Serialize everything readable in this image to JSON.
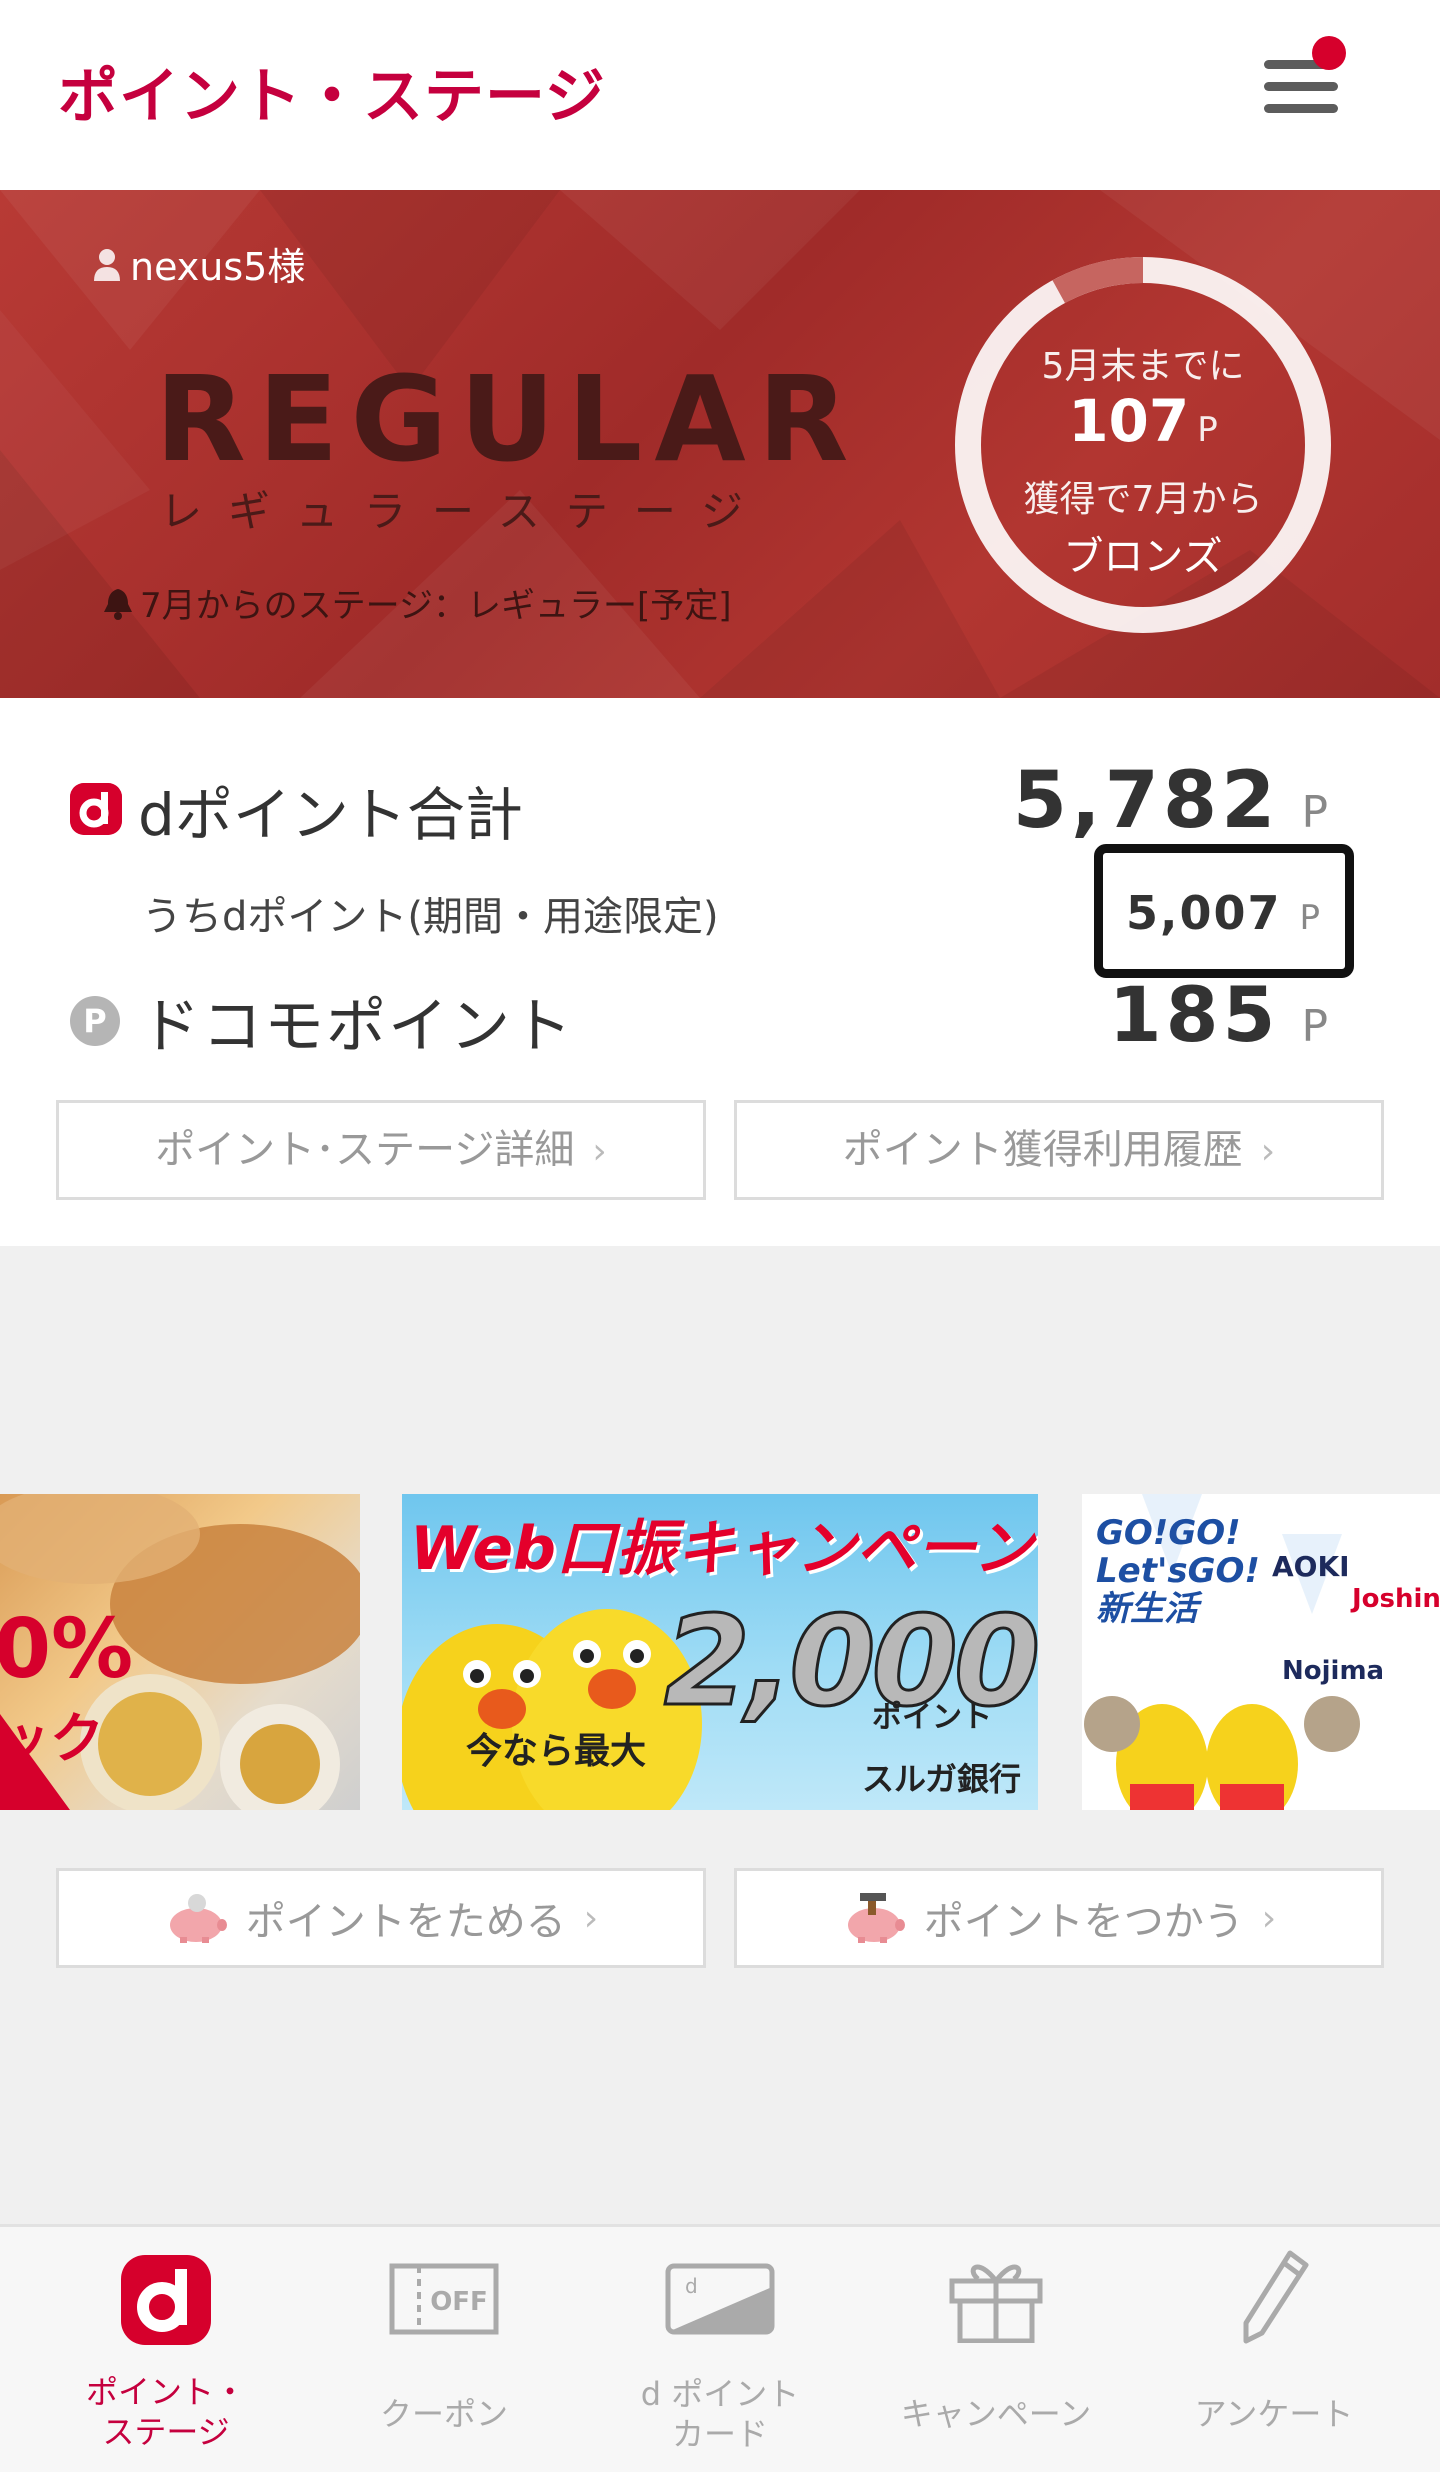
{
  "header": {
    "title": "ポイント・ステージ"
  },
  "stage": {
    "user": "nexus5様",
    "stage_name": "REGULAR",
    "stage_kana": "レギュラーステージ",
    "next_stage": "7月からのステージ：レギュラー[予定]",
    "ring": {
      "line1": "5月末までに",
      "points": "107",
      "unit": "P",
      "line3": "獲得で7月から",
      "line4": "ブロンズ",
      "progress": 0.08
    }
  },
  "points": {
    "total_label": "dポイント合計",
    "total_value": "5,782",
    "limited_label": "うちdポイント(期間・用途限定)",
    "limited_value": "5,007",
    "docomo_label": "ドコモポイント",
    "docomo_value": "185",
    "unit": "P",
    "p_icon": "P",
    "btn_detail": "ポイント･ステージ詳細",
    "btn_history": "ポイント獲得利用履歴"
  },
  "promos": {
    "left_text": "0%",
    "left_sub": "ック",
    "mid_title": "Web口振キャンペーン",
    "mid_prefix": "今なら最大",
    "mid_amount": "2,000",
    "mid_unit": "ポイント",
    "mid_bank": "スルガ銀行",
    "right_title": "GO!GO! Let'sGO! 新生活",
    "right_brand1": "AOKI",
    "right_brand2": "Joshin",
    "right_brand3": "Nojima"
  },
  "cta": {
    "save": "ポイントをためる",
    "use": "ポイントをつかう"
  },
  "nav": [
    {
      "label": "ポイント・\nステージ",
      "l1": "ポイント・",
      "l2": "ステージ"
    },
    {
      "label": "クーポン",
      "l1": "クーポン"
    },
    {
      "label": "d ポイント\nカード",
      "l1": "d ポイント",
      "l2": "カード"
    },
    {
      "label": "キャンペーン",
      "l1": "キャンペーン"
    },
    {
      "label": "アンケート",
      "l1": "アンケート"
    }
  ],
  "icons": {
    "off_label": "OFF",
    "card_d": "d"
  },
  "colors": {
    "brand": "#c5003e",
    "banner": "#a82f2c"
  }
}
